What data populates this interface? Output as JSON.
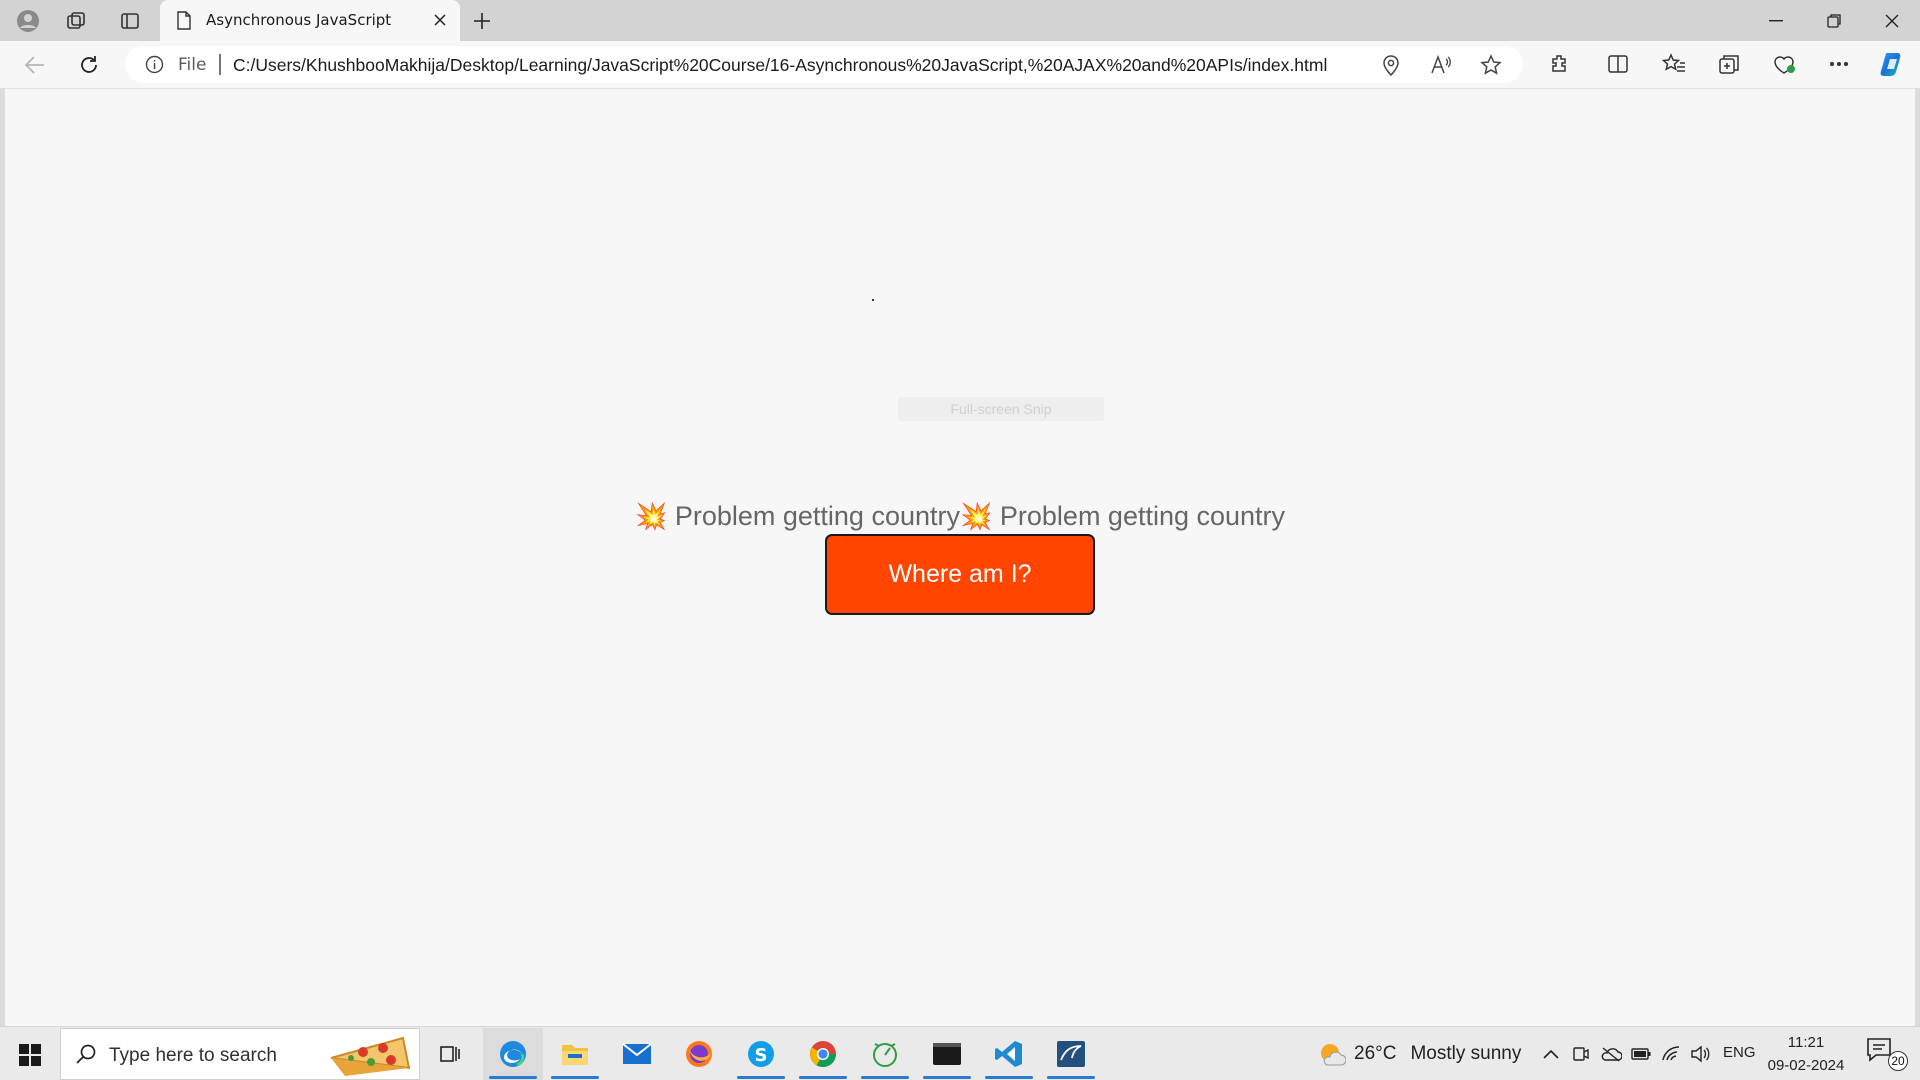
{
  "browser": {
    "tab": {
      "title": "Asynchronous JavaScript"
    },
    "address_bar": {
      "scheme_label": "File",
      "url": "C:/Users/KhushbooMakhija/Desktop/Learning/JavaScript%20Course/16-Asynchronous%20JavaScript,%20AJAX%20and%20APIs/index.html"
    }
  },
  "page": {
    "snip_overlay_text": "Full-screen Snip",
    "countries": [
      {
        "icon": "💥",
        "text": "Problem getting country"
      },
      {
        "icon": "💥",
        "text": "Problem getting country"
      }
    ],
    "button_label": "Where am I?",
    "accent_color": "#ff4500"
  },
  "taskbar": {
    "search_placeholder": "Type here to search",
    "apps": [
      "task-view",
      "edge",
      "file-explorer",
      "mail",
      "firefox",
      "skype",
      "chrome",
      "clock-app",
      "terminal",
      "vscode",
      "mysql-workbench"
    ],
    "weather": {
      "temperature": "26°C",
      "condition": "Mostly sunny"
    },
    "language": "ENG",
    "time": "11:21",
    "date": "09-02-2024",
    "notification_count": "20"
  }
}
